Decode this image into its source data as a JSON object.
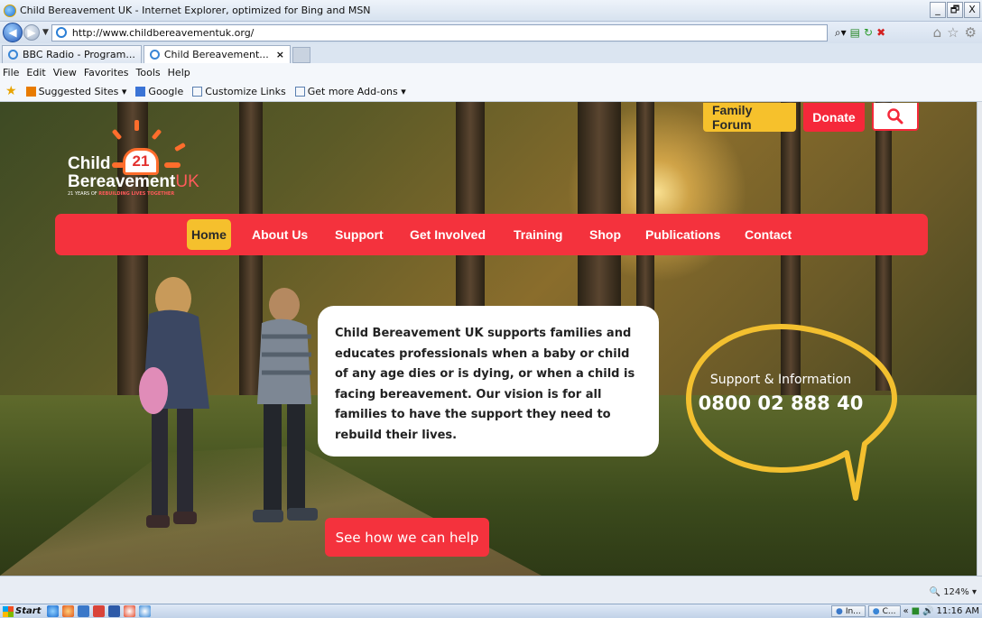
{
  "browser": {
    "window_title": "Child Bereavement UK - Internet Explorer, optimized for Bing and MSN",
    "url": "http://www.childbereavementuk.org/",
    "tabs": [
      {
        "label": "BBC Radio - Program..."
      },
      {
        "label": "Child Bereavement..."
      }
    ],
    "tab_close": "×",
    "menu": [
      "File",
      "Edit",
      "View",
      "Favorites",
      "Tools",
      "Help"
    ],
    "favorites": [
      "Suggested Sites ▾",
      "Google",
      "Customize Links",
      "Get more Add-ons ▾"
    ],
    "zoom": "124%",
    "window_controls": [
      "_",
      "🗗",
      "X"
    ]
  },
  "site": {
    "logo": {
      "line1": "Child",
      "badge": "21",
      "line2a": "Bereavement",
      "line2b": "UK",
      "tagline_a": "21 YEARS OF ",
      "tagline_b": "REBUILDING LIVES TOGETHER"
    },
    "top_buttons": {
      "forum": "Family Forum",
      "donate": "Donate",
      "search_icon": "search-icon"
    },
    "nav": [
      "Home",
      "About Us",
      "Support",
      "Get Involved",
      "Training",
      "Shop",
      "Publications",
      "Contact"
    ],
    "active_nav": "Home",
    "intro_text": "Child Bereavement UK supports families and educates professionals when a baby or child of any age dies or is dying, or when a child is facing bereavement. Our vision is for all families to have the support they need to rebuild their lives.",
    "helpline": {
      "label": "Support & Information",
      "number": "0800 02 888 40"
    },
    "cta": "See how we can help"
  },
  "taskbar": {
    "start": "Start",
    "tray_items": [
      "In...",
      "C..."
    ],
    "clock": "11:16 AM"
  },
  "colors": {
    "brand_red": "#f4323d",
    "brand_yellow": "#f5c02d",
    "bubble_yellow": "#f3c02f"
  }
}
